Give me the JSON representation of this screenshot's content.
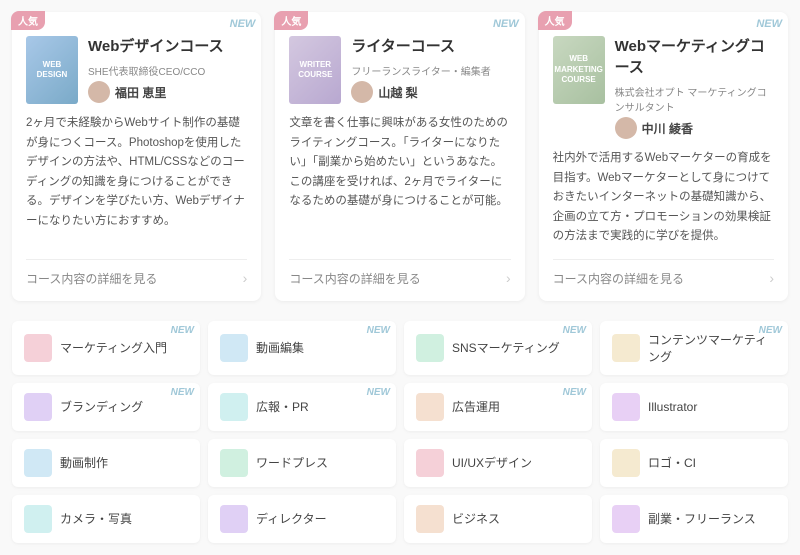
{
  "courses": [
    {
      "id": "web-design",
      "badge_ninkii": "人気",
      "badge_new": "NEW",
      "title": "Webデザインコース",
      "instructor_role": "SHE代表取締役CEO/CCO",
      "instructor_name": "福田 恵里",
      "book_label": "WEB\nDESIGN",
      "book_class": "book-web",
      "description": "2ヶ月で未経験からWebサイト制作の基礎が身につくコース。Photoshopを使用したデザインの方法や、HTML/CSSなどのコーディングの知識を身につけることができる。デザインを学びたい方、Webデザイナーになりたい方におすすめ。",
      "link_label": "コース内容の詳細を見る"
    },
    {
      "id": "writer",
      "badge_ninkii": "人気",
      "badge_new": "NEW",
      "title": "ライターコース",
      "instructor_role": "フリーランスライター・編集者",
      "instructor_name": "山越 梨",
      "book_label": "WRITER\nCOURSE",
      "book_class": "book-writer",
      "description": "文章を書く仕事に興味がある女性のためのライティングコース。「ライターになりたい」「副業から始めたい」というあなた。この講座を受ければ、2ヶ月でライターになるための基礎が身につけることが可能。",
      "link_label": "コース内容の詳細を見る"
    },
    {
      "id": "web-marketing",
      "badge_ninkii": "人気",
      "badge_new": "NEW",
      "title": "Webマーケティングコース",
      "instructor_role": "株式会社オプト マーケティングコンサルタント",
      "instructor_name": "中川 綾香",
      "book_label": "WEB\nMARKETING\nCOURSE",
      "book_class": "book-marketing",
      "description": "社内外で活用するWebマーケターの育成を目指す。Webマーケターとして身につけておきたいインターネットの基礎知識から、企画の立て方・プロモーションの効果検証の方法まで実践的に学びを提供。",
      "link_label": "コース内容の詳細を見る"
    }
  ],
  "categories": [
    {
      "id": "marketing",
      "label": "マーケティング入門",
      "icon_class": "cat-pink",
      "badge_new": "NEW"
    },
    {
      "id": "video-edit",
      "label": "動画編集",
      "icon_class": "cat-blue",
      "badge_new": "NEW"
    },
    {
      "id": "sns-marketing",
      "label": "SNSマーケティング",
      "icon_class": "cat-green",
      "badge_new": "NEW"
    },
    {
      "id": "content-marketing",
      "label": "コンテンツマーケティング",
      "icon_class": "cat-yellow",
      "badge_new": "NEW"
    },
    {
      "id": "branding",
      "label": "ブランディング",
      "icon_class": "cat-purple",
      "badge_new": "NEW"
    },
    {
      "id": "pr",
      "label": "広報・PR",
      "icon_class": "cat-mint",
      "badge_new": "NEW"
    },
    {
      "id": "ad-operation",
      "label": "広告運用",
      "icon_class": "cat-peach",
      "badge_new": "NEW"
    },
    {
      "id": "illustrator",
      "label": "Illustrator",
      "icon_class": "cat-lavender",
      "badge_new": ""
    },
    {
      "id": "video-production",
      "label": "動画制作",
      "icon_class": "cat-blue",
      "badge_new": ""
    },
    {
      "id": "wordpress",
      "label": "ワードプレス",
      "icon_class": "cat-green",
      "badge_new": ""
    },
    {
      "id": "ui-ux",
      "label": "UI/UXデザイン",
      "icon_class": "cat-pink",
      "badge_new": ""
    },
    {
      "id": "logo-ci",
      "label": "ロゴ・CI",
      "icon_class": "cat-yellow",
      "badge_new": ""
    },
    {
      "id": "camera-photo",
      "label": "カメラ・写真",
      "icon_class": "cat-mint",
      "badge_new": ""
    },
    {
      "id": "director",
      "label": "ディレクター",
      "icon_class": "cat-purple",
      "badge_new": ""
    },
    {
      "id": "business",
      "label": "ビジネス",
      "icon_class": "cat-peach",
      "badge_new": ""
    },
    {
      "id": "freelance",
      "label": "副業・フリーランス",
      "icon_class": "cat-lavender",
      "badge_new": ""
    }
  ]
}
